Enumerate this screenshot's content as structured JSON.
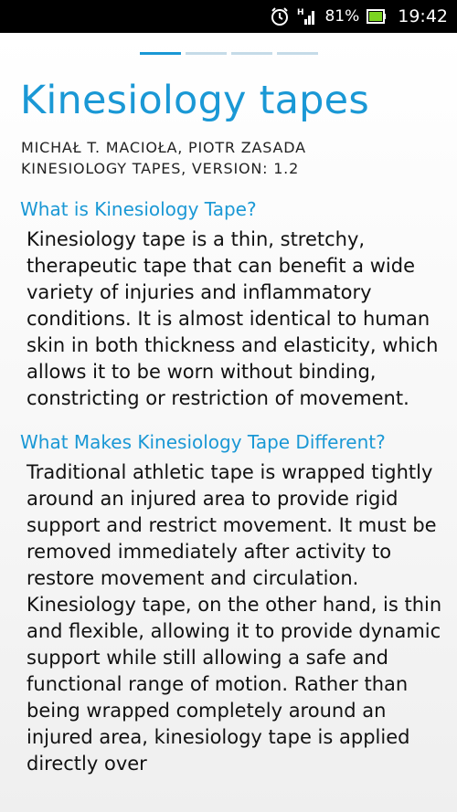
{
  "status_bar": {
    "battery_percent": "81%",
    "time": "19:42",
    "icons": [
      "alarm-icon",
      "signal-icon",
      "battery-icon"
    ]
  },
  "pager": {
    "pages": 4,
    "active": 0
  },
  "header": {
    "title": "Kinesiology tapes",
    "authors": "MICHAŁ T. MACIOŁA, PIOTR ZASADA",
    "version": "KINESIOLOGY TAPES, VERSION: 1.2"
  },
  "sections": [
    {
      "heading": "What is Kinesiology Tape?",
      "body": "Kinesiology tape is a thin, stretchy, therapeutic tape that can benefit a wide variety of injuries and inflammatory conditions. It is almost identical to human skin in both thickness and elasticity, which allows it to be worn without binding, constricting or restriction of movement."
    },
    {
      "heading": "What Makes Kinesiology Tape Different?",
      "body": "Traditional athletic tape is wrapped tightly around an injured area to provide rigid support and restrict movement. It must be removed immediately after activity to restore movement and circulation. Kinesiology tape, on the other hand, is thin and flexible, allowing it to provide dynamic support while still allowing a safe and functional range of motion. Rather than being wrapped completely around an injured area, kinesiology tape is applied directly over"
    }
  ],
  "colors": {
    "accent": "#1a98d5",
    "pager_inactive": "#c5dbe8",
    "status_bar": "#000000",
    "battery_fill": "#7bd321"
  }
}
